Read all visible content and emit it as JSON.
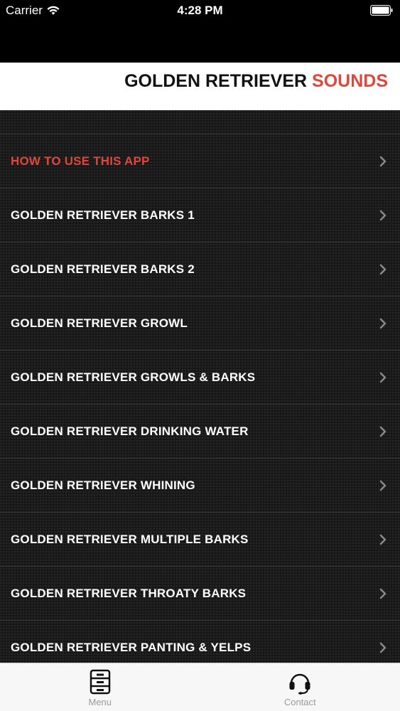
{
  "status_bar": {
    "carrier": "Carrier",
    "time": "4:28 PM"
  },
  "header": {
    "title_main": "GOLDEN RETRIEVER",
    "title_accent": "SOUNDS"
  },
  "colors": {
    "accent": "#e0463a",
    "menu_text": "#ffffff",
    "tab_label": "#9a9a9a"
  },
  "menu": {
    "items": [
      {
        "label": "HOW TO USE THIS APP",
        "highlight": true
      },
      {
        "label": "GOLDEN RETRIEVER BARKS 1"
      },
      {
        "label": "GOLDEN RETRIEVER BARKS 2"
      },
      {
        "label": "GOLDEN RETRIEVER GROWL"
      },
      {
        "label": "GOLDEN RETRIEVER GROWLS & BARKS"
      },
      {
        "label": "GOLDEN RETRIEVER DRINKING WATER"
      },
      {
        "label": "GOLDEN RETRIEVER WHINING"
      },
      {
        "label": "GOLDEN RETRIEVER MULTIPLE BARKS"
      },
      {
        "label": "GOLDEN RETRIEVER THROATY BARKS"
      },
      {
        "label": "GOLDEN RETRIEVER PANTING & YELPS"
      }
    ]
  },
  "tabs": [
    {
      "label": "Menu",
      "icon": "cabinet-icon"
    },
    {
      "label": "Contact",
      "icon": "headset-icon"
    }
  ]
}
